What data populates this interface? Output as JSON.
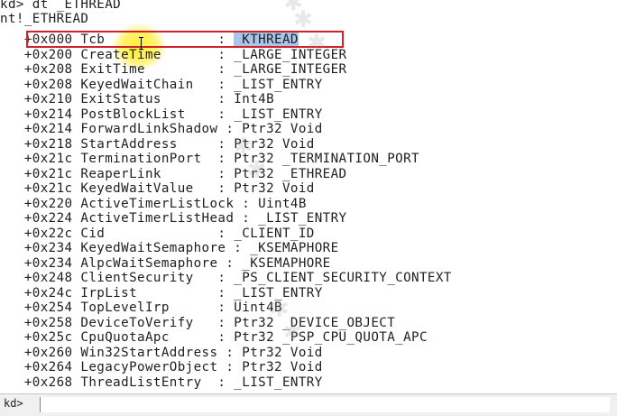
{
  "output": {
    "lines": [
      "kd> dt _ETHREAD",
      "nt!_ETHREAD",
      "   +0x000 Tcb              : _KTHREAD",
      "   +0x200 CreateTime       : _LARGE_INTEGER",
      "   +0x208 ExitTime         : _LARGE_INTEGER",
      "   +0x208 KeyedWaitChain   : _LIST_ENTRY",
      "   +0x210 ExitStatus       : Int4B",
      "   +0x214 PostBlockList    : _LIST_ENTRY",
      "   +0x214 ForwardLinkShadow : Ptr32 Void",
      "   +0x218 StartAddress     : Ptr32 Void",
      "   +0x21c TerminationPort  : Ptr32 _TERMINATION_PORT",
      "   +0x21c ReaperLink       : Ptr32 _ETHREAD",
      "   +0x21c KeyedWaitValue   : Ptr32 Void",
      "   +0x220 ActiveTimerListLock : Uint4B",
      "   +0x224 ActiveTimerListHead : _LIST_ENTRY",
      "   +0x22c Cid              : _CLIENT_ID",
      "   +0x234 KeyedWaitSemaphore : _KSEMAPHORE",
      "   +0x234 AlpcWaitSemaphore : _KSEMAPHORE",
      "   +0x248 ClientSecurity   : _PS_CLIENT_SECURITY_CONTEXT",
      "   +0x24c IrpList          : _LIST_ENTRY",
      "   +0x254 TopLevelIrp      : Uint4B",
      "   +0x258 DeviceToVerify   : Ptr32 _DEVICE_OBJECT",
      "   +0x25c CpuQuotaApc      : Ptr32 _PSP_CPU_QUOTA_APC",
      "   +0x260 Win32StartAddress : Ptr32 Void",
      "   +0x264 LegacyPowerObject : Ptr32 Void",
      "   +0x268 ThreadListEntry  : _LIST_ENTRY"
    ],
    "tcb_prefix": "   +0x000 Tcb              : ",
    "tcb_selected": "_KTHREAD"
  },
  "command_bar": {
    "prompt": "kd>",
    "input_value": ""
  },
  "colors": {
    "selection": "#a9c6e8",
    "annotation_box": "#d0202a",
    "cursor_highlight": "#ffee3c"
  }
}
